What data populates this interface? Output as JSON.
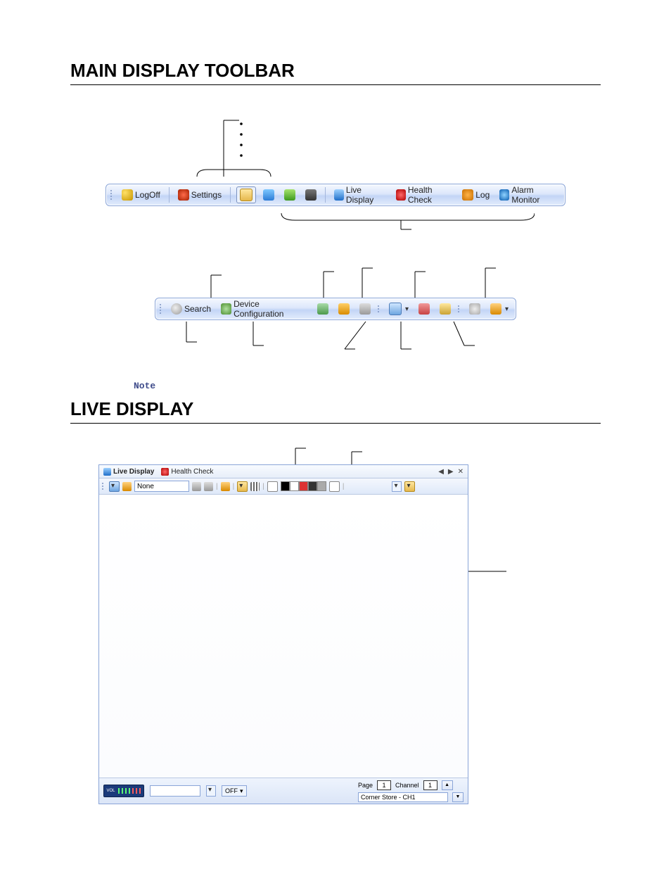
{
  "headings": {
    "main_toolbar": "MAIN DISPLAY TOOLBAR",
    "live_display": "LIVE DISPLAY"
  },
  "note_label": "Note",
  "toolbar1": {
    "logoff": "LogOff",
    "settings": "Settings",
    "live_display": "Live Display",
    "health_check": "Health Check",
    "log": "Log",
    "alarm_monitor": "Alarm Monitor"
  },
  "toolbar2": {
    "search": "Search",
    "device_config": "Device Configuration"
  },
  "live": {
    "tabs": {
      "live_display": "Live Display",
      "health_check": "Health Check"
    },
    "tab_nav": {
      "prev": "◀",
      "next": "▶",
      "close": "✕"
    },
    "none": "None",
    "off": "OFF",
    "page_label": "Page",
    "page_value": "1",
    "channel_label": "Channel",
    "channel_value": "1",
    "status": "Corner Store - CH1",
    "vol_label": "VOL"
  }
}
